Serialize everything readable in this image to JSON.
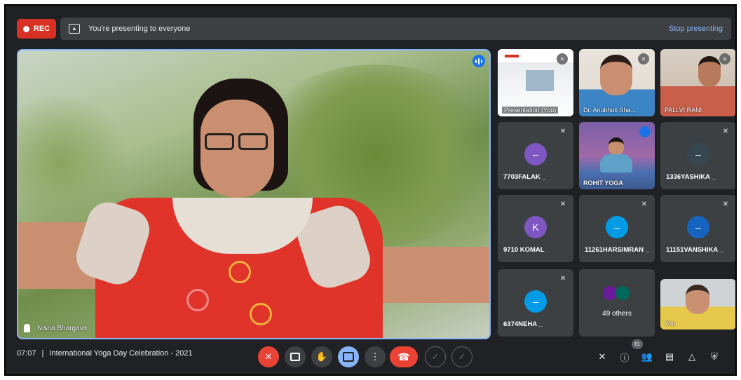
{
  "top_bar": {
    "rec_label": "REC",
    "presenting_text": "You're presenting to everyone",
    "stop_presenting": "Stop presenting"
  },
  "main_speaker": {
    "name": "Nisha Bhargava",
    "speaking": true
  },
  "tiles": [
    {
      "name": "Presentation (You)",
      "type": "presentation",
      "muted": true
    },
    {
      "name": "Dr. Anubhuti Sha...",
      "type": "video",
      "muted": true
    },
    {
      "name": "PALLVI RANI",
      "type": "video",
      "muted": true
    },
    {
      "name": "7703FALAK _",
      "type": "avatar",
      "initial": "–",
      "color": "#7e57c2",
      "muted": true
    },
    {
      "name": "ROHIT YOGA",
      "type": "video",
      "speaking": true
    },
    {
      "name": "1336YASHIKA _",
      "type": "avatar",
      "initial": "–",
      "color": "#37474f",
      "muted": true
    },
    {
      "name": "9710 KOMAL",
      "type": "avatar",
      "initial": "K",
      "color": "#7e57c2",
      "muted": true
    },
    {
      "name": "11261HARSIMRAN _",
      "type": "avatar",
      "initial": "–",
      "color": "#039be5",
      "muted": true
    },
    {
      "name": "11151VANSHIKA _",
      "type": "avatar",
      "initial": "–",
      "color": "#1565c0",
      "muted": true
    },
    {
      "name": "6374NEHA _",
      "type": "avatar",
      "initial": "–",
      "color": "#039be5",
      "muted": true
    },
    {
      "name": "49 others",
      "type": "others"
    },
    {
      "name": "You",
      "type": "video"
    }
  ],
  "bottom_bar": {
    "time": "07:07",
    "separator": "|",
    "meeting_title": "International Yoga Day Celebration - 2021",
    "participant_count": "61"
  },
  "colors": {
    "background": "#202124",
    "tile": "#3c4043",
    "accent": "#8ab4f8",
    "end_call": "#ea4335",
    "rec": "#d93025"
  }
}
